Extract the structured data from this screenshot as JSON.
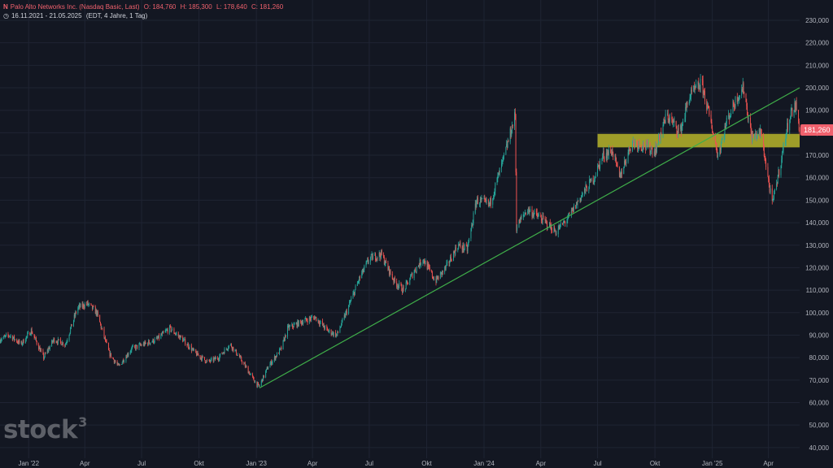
{
  "header": {
    "symbol_icon": "exchange-logo-icon",
    "title": "Palo Alto Networks Inc. (Nasdaq Basic, Last)",
    "open": "O: 184,760",
    "high": "H: 185,300",
    "low": "L: 178,640",
    "close": "C: 181,260",
    "range_icon": "clock-icon",
    "range": "16.11.2021 - 21.05.2025",
    "meta": "(EDT, 4 Jahre, 1 Tag)"
  },
  "last_price_label": "181,260",
  "watermark": {
    "text": "stock",
    "sup": "3"
  },
  "colors": {
    "background": "#131722",
    "grid": "#1f2433",
    "up": "#26a69a",
    "down": "#ef5350",
    "trendline": "#3fae49",
    "zone": "#b7b52a",
    "price_tag": "#f0616d"
  },
  "chart_data": {
    "type": "candlestick",
    "x_range": [
      "2021-11-16",
      "2025-05-21"
    ],
    "ylim": [
      40000,
      235000
    ],
    "yticks": [
      40000,
      50000,
      60000,
      70000,
      80000,
      90000,
      100000,
      110000,
      120000,
      130000,
      140000,
      150000,
      160000,
      170000,
      180000,
      190000,
      200000,
      210000,
      220000,
      230000
    ],
    "ytick_labels": [
      "40,000",
      "50,000",
      "60,000",
      "70,000",
      "80,000",
      "90,000",
      "100,000",
      "110,000",
      "120,000",
      "130,000",
      "140,000",
      "150,000",
      "160,000",
      "170,000",
      "180,000",
      "190,000",
      "200,000",
      "210,000",
      "220,000",
      "230,000"
    ],
    "xticks": [
      {
        "date": "2022-01-01",
        "label": "Jan '22"
      },
      {
        "date": "2022-04-01",
        "label": "Apr"
      },
      {
        "date": "2022-07-01",
        "label": "Jul"
      },
      {
        "date": "2022-10-01",
        "label": "Okt"
      },
      {
        "date": "2023-01-01",
        "label": "Jan '23"
      },
      {
        "date": "2023-04-01",
        "label": "Apr"
      },
      {
        "date": "2023-07-01",
        "label": "Jul"
      },
      {
        "date": "2023-10-01",
        "label": "Okt"
      },
      {
        "date": "2024-01-01",
        "label": "Jan '24"
      },
      {
        "date": "2024-04-01",
        "label": "Apr"
      },
      {
        "date": "2024-07-01",
        "label": "Jul"
      },
      {
        "date": "2024-10-01",
        "label": "Okt"
      },
      {
        "date": "2025-01-01",
        "label": "Jan '25"
      },
      {
        "date": "2025-04-01",
        "label": "Apr"
      }
    ],
    "price_path": [
      [
        "2021-11-16",
        88000
      ],
      [
        "2021-12-01",
        90000
      ],
      [
        "2021-12-20",
        86000
      ],
      [
        "2022-01-05",
        92000
      ],
      [
        "2022-01-25",
        80000
      ],
      [
        "2022-02-10",
        88000
      ],
      [
        "2022-03-01",
        86000
      ],
      [
        "2022-03-20",
        102000
      ],
      [
        "2022-04-05",
        104000
      ],
      [
        "2022-04-20",
        100000
      ],
      [
        "2022-05-10",
        82000
      ],
      [
        "2022-05-25",
        76000
      ],
      [
        "2022-06-15",
        84000
      ],
      [
        "2022-07-05",
        86000
      ],
      [
        "2022-07-25",
        88000
      ],
      [
        "2022-08-15",
        93000
      ],
      [
        "2022-09-05",
        88000
      ],
      [
        "2022-09-25",
        82000
      ],
      [
        "2022-10-15",
        78000
      ],
      [
        "2022-11-01",
        80000
      ],
      [
        "2022-11-20",
        86000
      ],
      [
        "2022-12-10",
        78000
      ],
      [
        "2022-12-28",
        70000
      ],
      [
        "2023-01-05",
        67000
      ],
      [
        "2023-01-20",
        76000
      ],
      [
        "2023-02-10",
        84000
      ],
      [
        "2023-02-20",
        93000
      ],
      [
        "2023-03-15",
        96000
      ],
      [
        "2023-04-05",
        98000
      ],
      [
        "2023-04-25",
        92000
      ],
      [
        "2023-05-10",
        90000
      ],
      [
        "2023-05-25",
        100000
      ],
      [
        "2023-06-15",
        115000
      ],
      [
        "2023-07-01",
        124000
      ],
      [
        "2023-07-20",
        126000
      ],
      [
        "2023-08-10",
        114000
      ],
      [
        "2023-08-25",
        110000
      ],
      [
        "2023-09-10",
        118000
      ],
      [
        "2023-09-25",
        124000
      ],
      [
        "2023-10-15",
        114000
      ],
      [
        "2023-11-01",
        120000
      ],
      [
        "2023-11-20",
        130000
      ],
      [
        "2023-12-05",
        128000
      ],
      [
        "2023-12-20",
        150000
      ],
      [
        "2024-01-10",
        148000
      ],
      [
        "2024-02-01",
        168000
      ],
      [
        "2024-02-20",
        188000
      ],
      [
        "2024-02-22",
        138000
      ],
      [
        "2024-03-10",
        146000
      ],
      [
        "2024-04-01",
        142000
      ],
      [
        "2024-04-25",
        136000
      ],
      [
        "2024-05-15",
        142000
      ],
      [
        "2024-06-05",
        152000
      ],
      [
        "2024-06-25",
        160000
      ],
      [
        "2024-07-10",
        170000
      ],
      [
        "2024-07-25",
        172000
      ],
      [
        "2024-08-05",
        160000
      ],
      [
        "2024-08-25",
        176000
      ],
      [
        "2024-09-15",
        174000
      ],
      [
        "2024-10-01",
        172000
      ],
      [
        "2024-10-20",
        188000
      ],
      [
        "2024-11-10",
        180000
      ],
      [
        "2024-11-25",
        196000
      ],
      [
        "2024-12-15",
        202000
      ],
      [
        "2024-12-30",
        184000
      ],
      [
        "2025-01-10",
        170000
      ],
      [
        "2025-01-25",
        186000
      ],
      [
        "2025-02-10",
        196000
      ],
      [
        "2025-02-20",
        200000
      ],
      [
        "2025-03-05",
        178000
      ],
      [
        "2025-03-20",
        180000
      ],
      [
        "2025-04-07",
        148000
      ],
      [
        "2025-04-20",
        166000
      ],
      [
        "2025-05-05",
        188000
      ],
      [
        "2025-05-15",
        192000
      ],
      [
        "2025-05-21",
        181260
      ]
    ],
    "trendline": {
      "start": [
        "2023-01-06",
        66500
      ],
      "end": [
        "2025-05-21",
        200000
      ]
    },
    "zone": {
      "start": "2024-07-01",
      "y_low": 173500,
      "y_high": 179500
    },
    "last_price": 181260
  }
}
